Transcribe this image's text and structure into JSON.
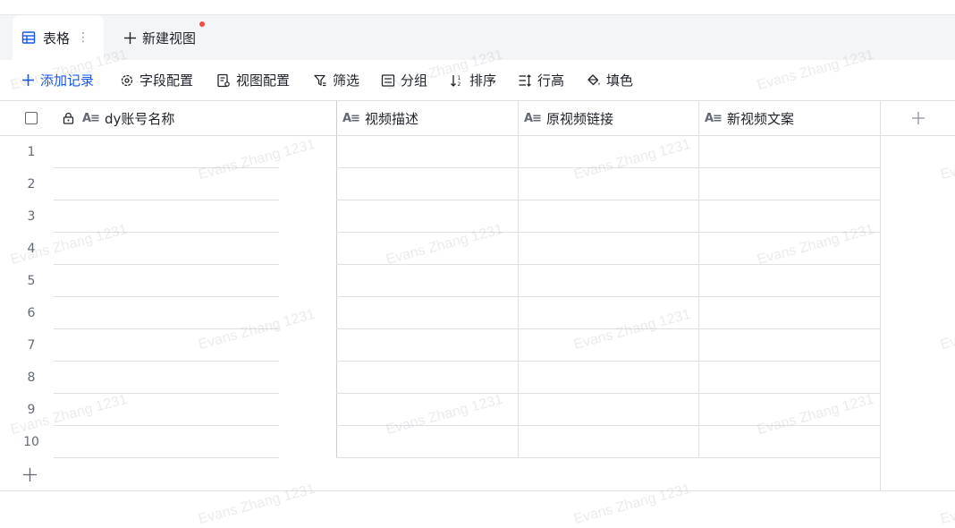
{
  "tabs": {
    "active_label": "表格",
    "new_view_label": "新建视图"
  },
  "toolbar": {
    "add_record": "添加记录",
    "field_config": "字段配置",
    "view_config": "视图配置",
    "filter": "筛选",
    "group": "分组",
    "sort": "排序",
    "row_height": "行高",
    "fill_color": "填色"
  },
  "table": {
    "columns": [
      "dy账号名称",
      "视频描述",
      "原视频链接",
      "新视频文案"
    ],
    "rows": [
      "1",
      "2",
      "3",
      "4",
      "5",
      "6",
      "7",
      "8",
      "9",
      "10"
    ]
  },
  "watermark": "Evans Zhang 1231",
  "colors": {
    "accent": "#1456f0",
    "tabbar_bg": "#f4f5f7",
    "border": "#dee0e3",
    "badge_dot": "#f54a45"
  }
}
